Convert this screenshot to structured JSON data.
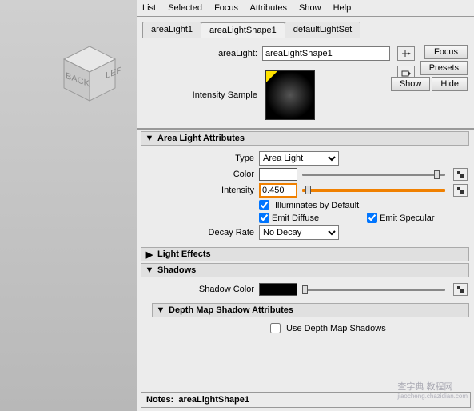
{
  "menubar": [
    "List",
    "Selected",
    "Focus",
    "Attributes",
    "Show",
    "Help"
  ],
  "tabs": [
    {
      "label": "areaLight1",
      "active": false
    },
    {
      "label": "areaLightShape1",
      "active": true
    },
    {
      "label": "defaultLightSet",
      "active": false
    }
  ],
  "header": {
    "name_label": "areaLight:",
    "name_value": "areaLightShape1",
    "focus_btn": "Focus",
    "presets_btn": "Presets",
    "show_btn": "Show",
    "hide_btn": "Hide"
  },
  "sample_label": "Intensity Sample",
  "sections": {
    "area_light": {
      "title": "Area Light Attributes",
      "type_label": "Type",
      "type_value": "Area Light",
      "color_label": "Color",
      "intensity_label": "Intensity",
      "intensity_value": "0.450",
      "illuminates": "Illuminates by Default",
      "emit_diffuse": "Emit Diffuse",
      "emit_specular": "Emit Specular",
      "decay_label": "Decay Rate",
      "decay_value": "No Decay"
    },
    "light_effects": {
      "title": "Light Effects"
    },
    "shadows": {
      "title": "Shadows",
      "shadow_color_label": "Shadow Color"
    },
    "depth_map": {
      "title": "Depth Map Shadow Attributes",
      "use_depth": "Use Depth Map Shadows"
    }
  },
  "notes": {
    "label": "Notes:",
    "value": "areaLightShape1"
  },
  "watermark": {
    "main": "查字典 教程网",
    "sub": "jiaocheng.chazidian.com"
  }
}
